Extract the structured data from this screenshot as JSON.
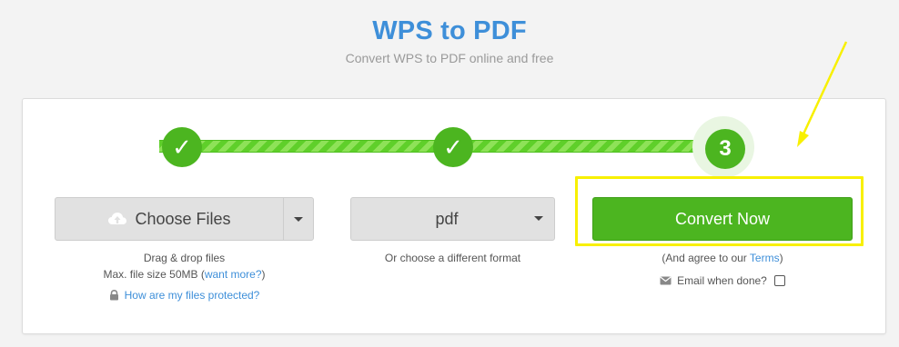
{
  "header": {
    "title": "WPS to PDF",
    "subtitle": "Convert WPS to PDF online and free"
  },
  "steps": [
    {
      "label": "✓",
      "state": "done"
    },
    {
      "label": "✓",
      "state": "done"
    },
    {
      "label": "3",
      "state": "current"
    }
  ],
  "upload": {
    "button_label": "Choose Files",
    "icon": "cloud-upload-icon",
    "drag_text": "Drag & drop files",
    "max_text": "Max. file size 50MB (",
    "want_more_link": "want more?",
    "max_text_end": ")",
    "protected_link": "How are my files protected?",
    "protected_icon": "lock-icon"
  },
  "format": {
    "selected": "pdf",
    "hint": "Or choose a different format"
  },
  "convert": {
    "button_label": "Convert Now",
    "agree_prefix": "(And agree to our ",
    "terms_link": "Terms",
    "agree_suffix": ")",
    "email_label": "Email when done?",
    "email_icon": "envelope-icon",
    "email_checked": false
  },
  "colors": {
    "accent_green": "#4cb520",
    "title_blue": "#3e8fd9",
    "highlight_yellow": "#f8f000"
  }
}
